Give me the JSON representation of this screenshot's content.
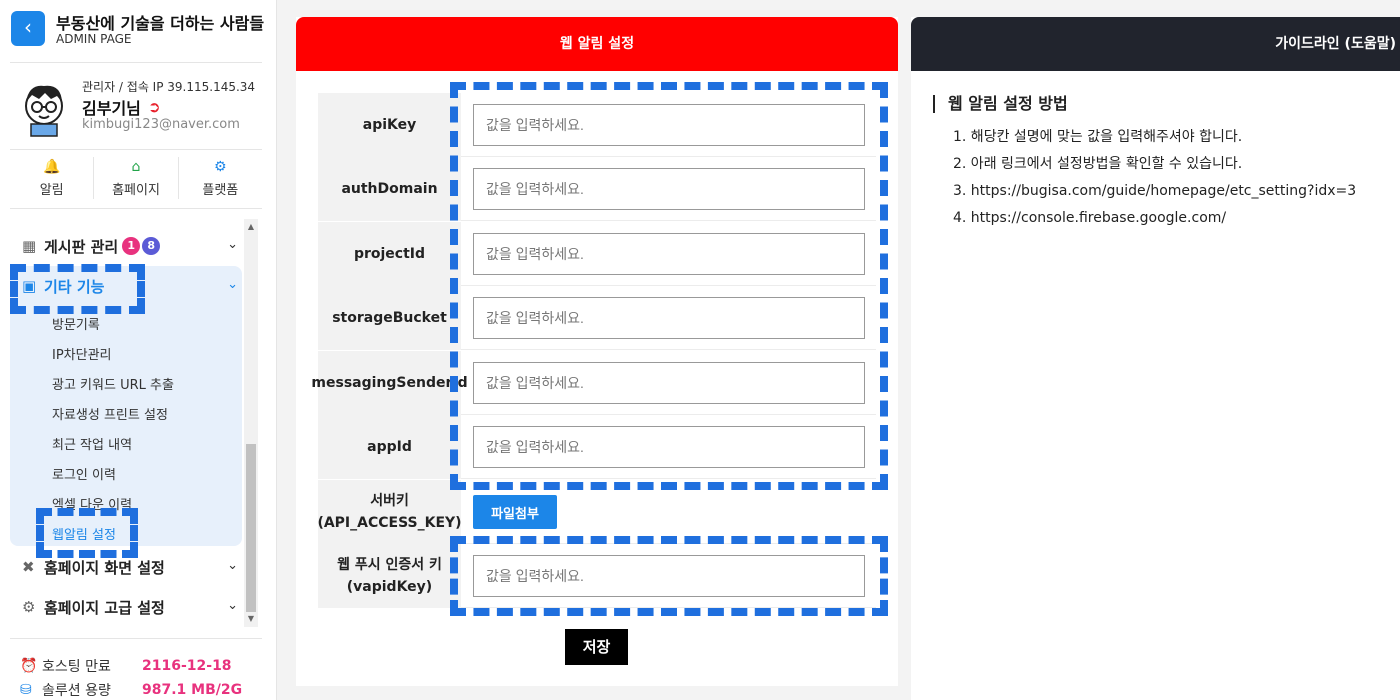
{
  "brand": {
    "title": "부동산에 기술을 더하는 사람들",
    "subtitle": "ADMIN PAGE",
    "back_icon": "chevron-left-icon"
  },
  "profile": {
    "role": "관리자 / 접속 IP 39.115.145.34",
    "name": "김부기님",
    "email": "kimbugi123@naver.com"
  },
  "quick_links": [
    {
      "label": "알림",
      "icon": "bell-icon",
      "color": "#f2b705"
    },
    {
      "label": "홈페이지",
      "icon": "home-icon",
      "color": "#22a44a"
    },
    {
      "label": "플랫폼",
      "icon": "platform-icon",
      "color": "#1c86e8"
    }
  ],
  "menu": {
    "board": {
      "label": "게시판 관리",
      "badge1": "1",
      "badge2": "8"
    },
    "etc": {
      "label": "기타 기능",
      "items": [
        "방문기록",
        "IP차단관리",
        "광고 키워드 URL 추출",
        "자료생성 프린트 설정",
        "최근 작업 내역",
        "로그인 이력",
        "엑셀 다운 이력",
        "웹알림 설정"
      ]
    },
    "homepage_screen": {
      "label": "홈페이지 화면 설정"
    },
    "homepage_advanced": {
      "label": "홈페이지 고급 설정"
    }
  },
  "stats": {
    "hosting": {
      "label": "호스팅 만료",
      "value": "2116-12-18"
    },
    "capacity": {
      "label": "솔루션 용량",
      "value": "987.1 MB/2G"
    }
  },
  "panel": {
    "title": "웹 알림 설정",
    "placeholder": "값을 입력하세요.",
    "fields": [
      {
        "label": "apiKey",
        "value": ""
      },
      {
        "label": "authDomain",
        "value": ""
      },
      {
        "label": "projectId",
        "value": ""
      },
      {
        "label": "storageBucket",
        "value": ""
      },
      {
        "label": "messagingSenderId",
        "value": ""
      },
      {
        "label": "appId",
        "value": ""
      }
    ],
    "server_key": {
      "label1": "서버키",
      "label2": "(API_ACCESS_KEY)",
      "button": "파일첨부"
    },
    "vapid": {
      "label1": "웹 푸시 인증서 키",
      "label2": "(vapidKey)",
      "value": ""
    },
    "save": "저장"
  },
  "guide": {
    "header": "가이드라인 (도움말)",
    "title": "웹 알림 설정 방법",
    "items": [
      "1. 해당칸 설명에 맞는 값을 입력해주셔야 합니다.",
      "2. 아래 링크에서 설정방법을 확인할 수 있습니다.",
      "3. https://bugisa.com/guide/homepage/etc_setting?idx=3",
      "4. https://console.firebase.google.com/"
    ]
  },
  "colors": {
    "accent_blue": "#1c86e8",
    "header_red": "#ff0000",
    "guide_dark": "#21242d",
    "badge_pink": "#e8327e",
    "badge_purple": "#5b5bd6",
    "highlight": "#1f6fde"
  }
}
